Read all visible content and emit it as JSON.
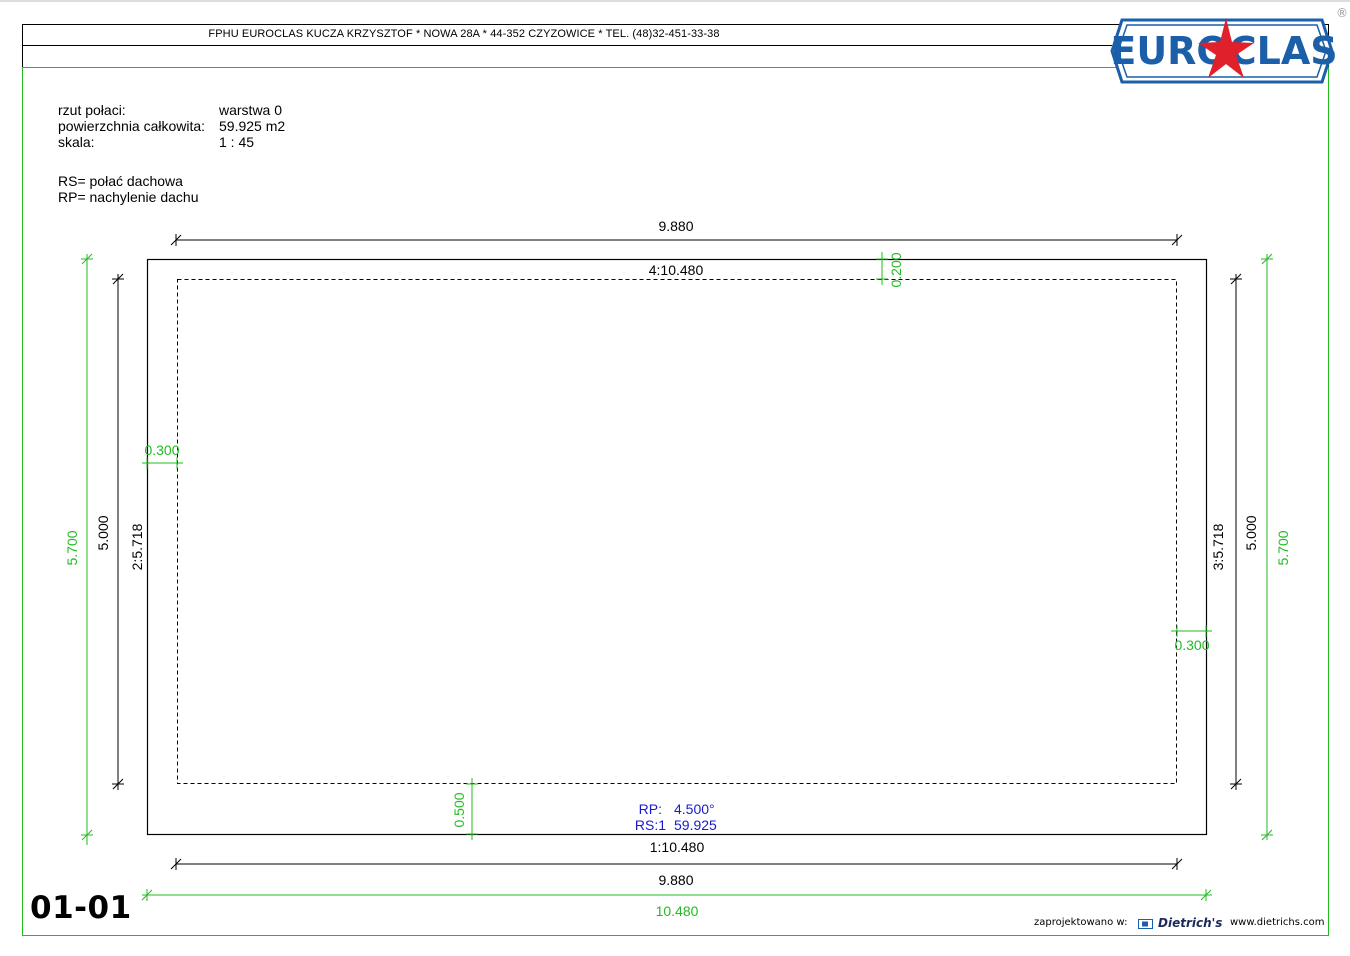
{
  "header": {
    "company_line": "FPHU EUROCLAS KUCZA KRZYSZTOF * NOWA 28A * 44-352 CZYZOWICE * TEL. (48)32-451-33-38",
    "logo_text": "EUROCLAS",
    "registered_mark": "®"
  },
  "info": {
    "roof_plan_label": "rzut połaci:",
    "roof_plan_value": "warstwa 0",
    "total_area_label": "powierzchnia całkowita:",
    "total_area_value": "59.925 m2",
    "scale_label": "skala:",
    "scale_value": "1 : 45"
  },
  "legend": {
    "rs": "RS= połać dachowa",
    "rp": "RP= nachylenie dachu"
  },
  "dimensions": {
    "top_outer": "9.880",
    "top_edge": "4:10.480",
    "top_overhang": "0.200",
    "left_overhang": "0.300",
    "left_green": "5.700",
    "left_black": "5.000",
    "left_edge": "2:5.718",
    "right_edge": "3:5.718",
    "right_black": "5.000",
    "right_green": "5.700",
    "right_overhang": "0.300",
    "bottom_overhang": "0.500",
    "bottom_edge": "1:10.480",
    "bottom_black": "9.880",
    "bottom_green": "10.480"
  },
  "roof_label": {
    "rp_key": "RP:",
    "rp_value": "4.500°",
    "rs_key": "RS:1",
    "rs_value": "59.925"
  },
  "sheet": {
    "number": "01-01"
  },
  "footer": {
    "designed_in": "zaprojektowano w:",
    "software": "Dietrich's",
    "website": "www.dietrichs.com"
  },
  "colors": {
    "green": "#22bb22",
    "blue": "#1a1acc",
    "logo_blue": "#1b5fa8",
    "logo_red": "#e0202a"
  }
}
